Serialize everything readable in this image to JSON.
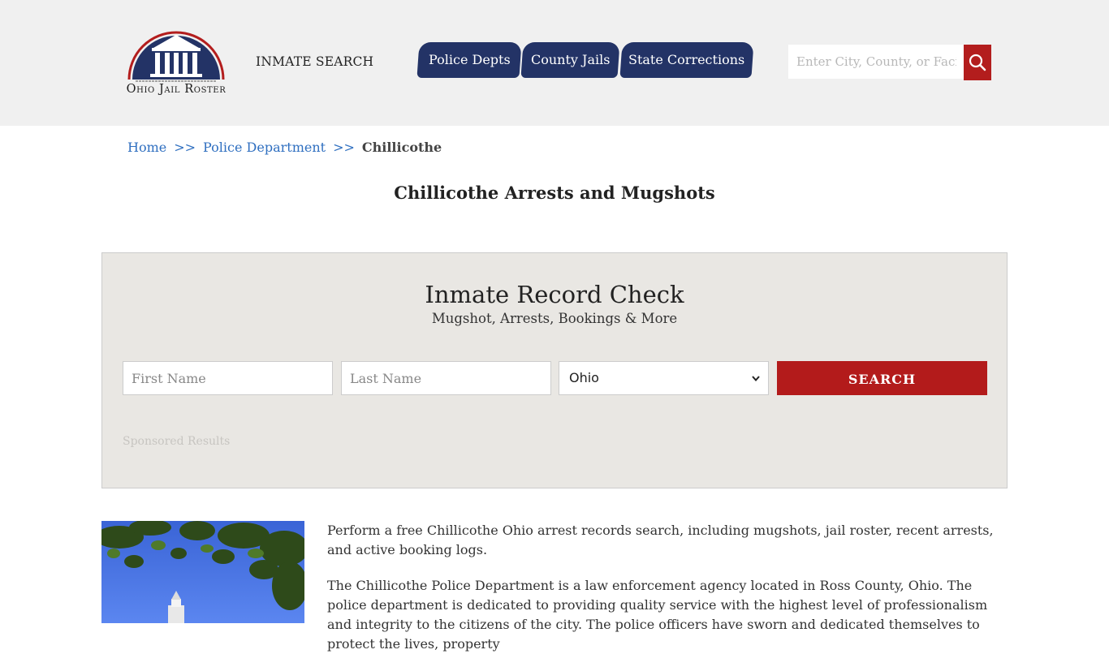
{
  "header": {
    "logo_text": "Ohio Jail Roster",
    "inmate_search_label": "INMATE SEARCH",
    "nav": [
      {
        "label": "Police Depts"
      },
      {
        "label": "County Jails"
      },
      {
        "label": "State Corrections"
      }
    ],
    "search": {
      "placeholder": "Enter City, County, or Facility",
      "icon": "magnifier-icon"
    }
  },
  "breadcrumb": {
    "items": [
      "Home",
      "Police Department",
      "Chillicothe"
    ],
    "separator": ">>"
  },
  "page_title": "Chillicothe Arrests and Mugshots",
  "record_check": {
    "title": "Inmate Record Check",
    "subtitle": "Mugshot, Arrests, Bookings & More",
    "first_name_placeholder": "First Name",
    "last_name_placeholder": "Last Name",
    "state_selected": "Ohio",
    "button_label": "SEARCH",
    "sponsored_label": "Sponsored Results"
  },
  "content": {
    "paragraphs": [
      "Perform a free Chillicothe Ohio arrest records search, including mugshots, jail roster, recent arrests, and active booking logs.",
      "The Chillicothe Police Department is a law enforcement agency located in Ross County, Ohio. The police department is dedicated to providing quality service with the highest level of professionalism and integrity to the citizens of the city. The police officers have sworn and dedicated themselves to protect the lives, property"
    ]
  },
  "colors": {
    "nav_bg": "#233366",
    "accent_red": "#b31b1b",
    "link_blue": "#2f6fc0",
    "header_bg": "#f0f0f0",
    "panel_bg": "#e9e7e3"
  }
}
